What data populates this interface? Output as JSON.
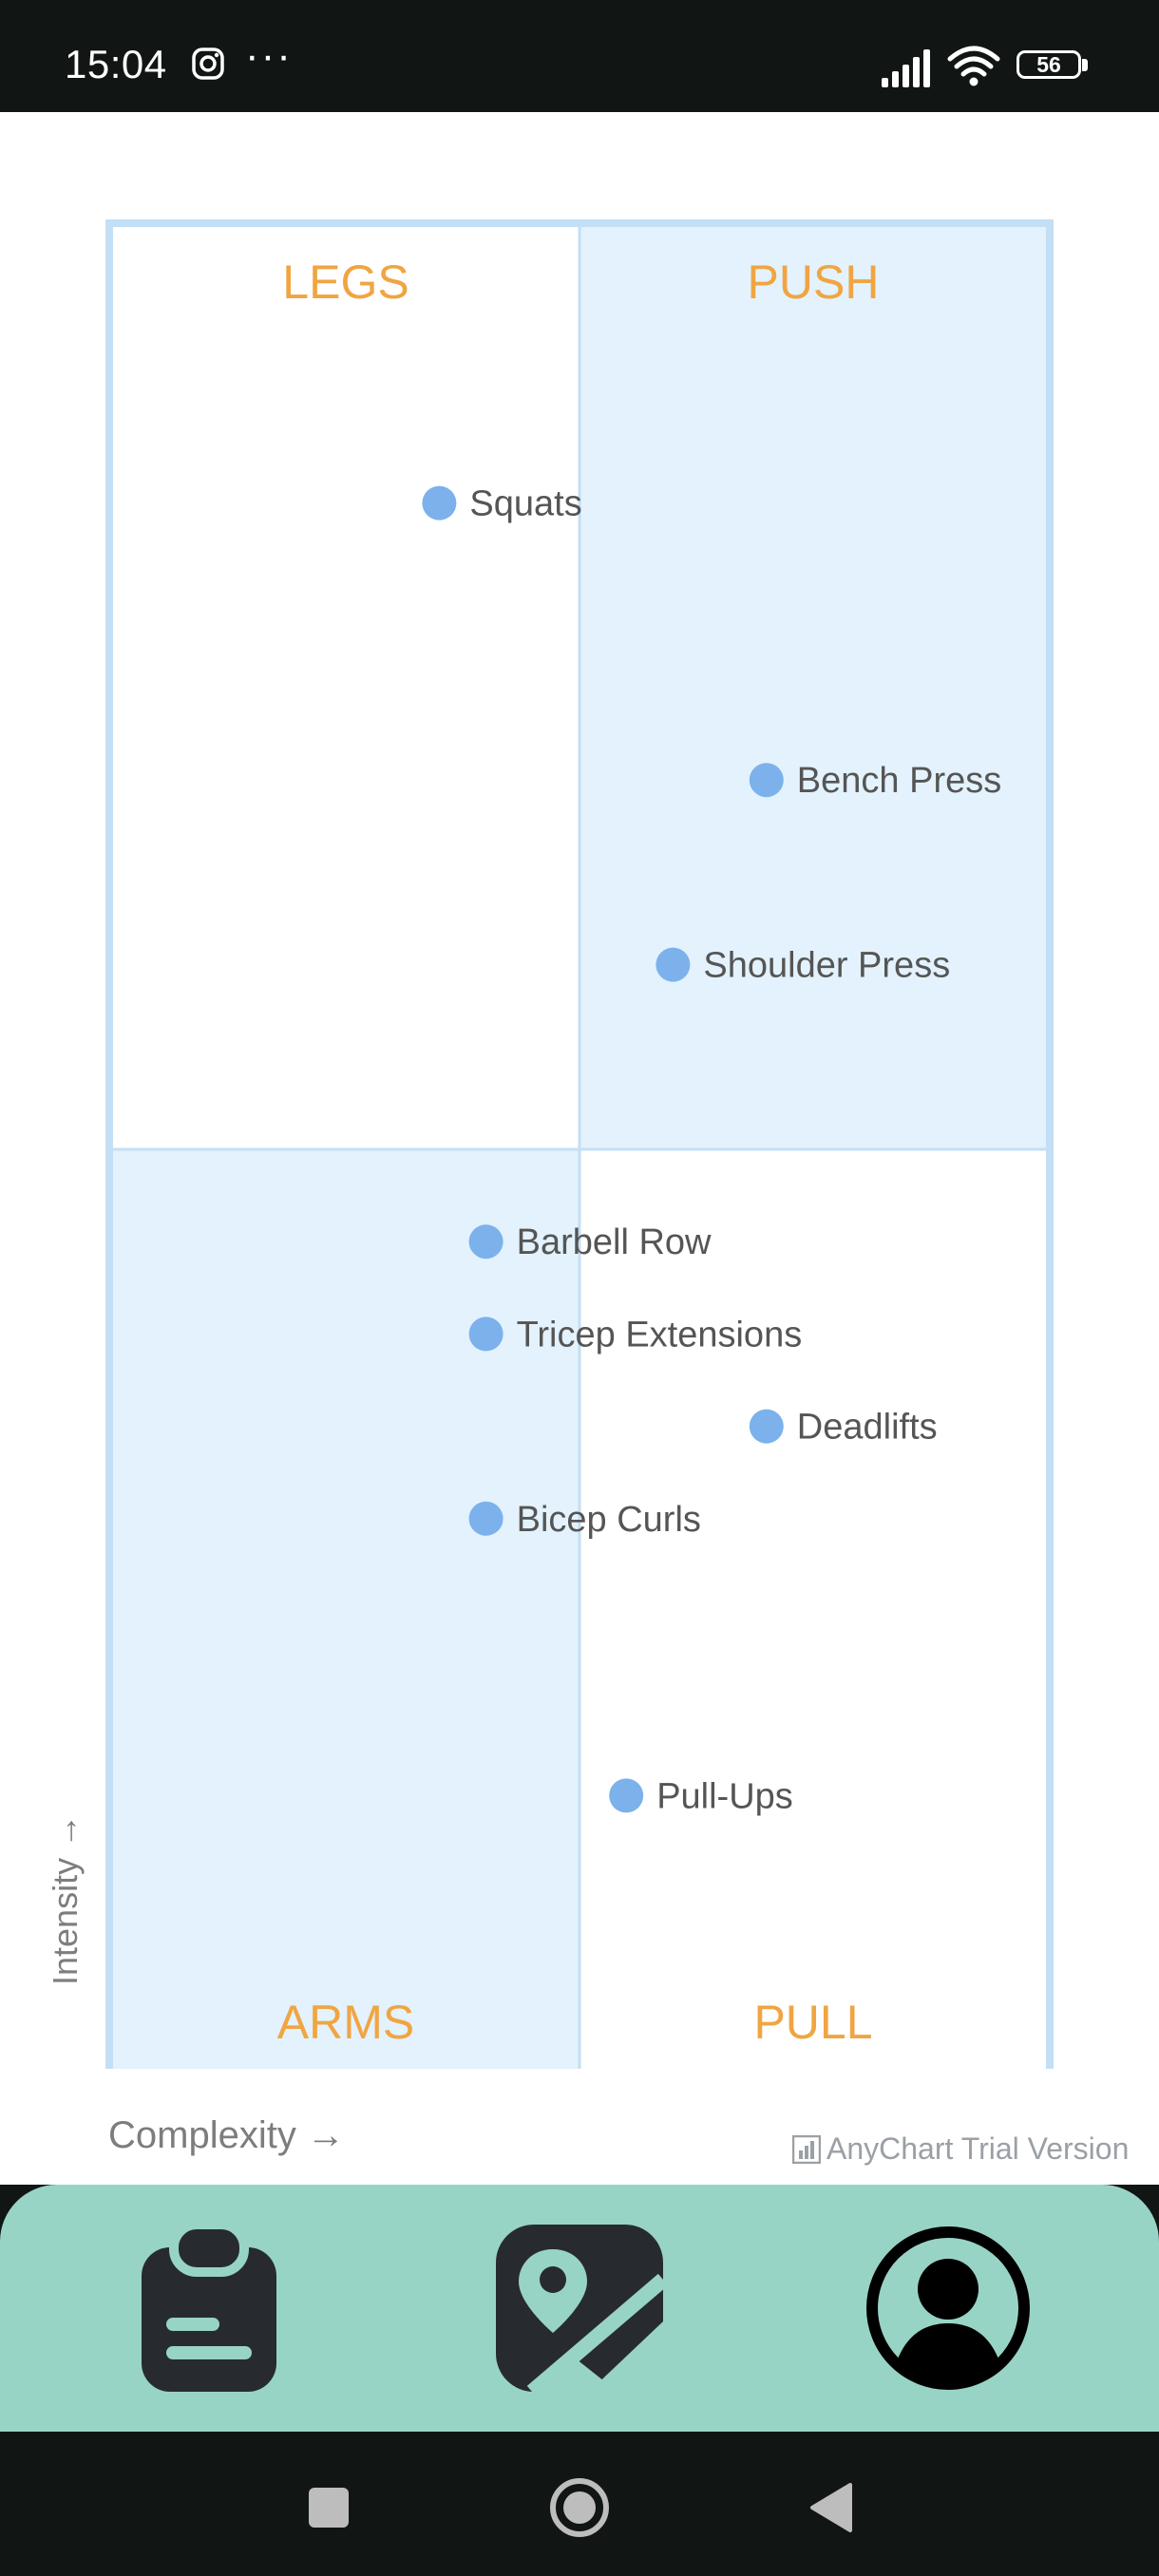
{
  "status_bar": {
    "time": "15:04",
    "more": "···",
    "battery": "56",
    "icons": [
      "instagram-icon",
      "signal-icon",
      "wifi-icon",
      "battery-icon"
    ]
  },
  "chart_data": {
    "type": "scatter",
    "subtype": "quadrant",
    "xlabel": "Complexity →",
    "ylabel": "Intensity →",
    "xlim": [
      0,
      100
    ],
    "ylim": [
      0,
      100
    ],
    "grid": false,
    "legend": "none",
    "quadrants": [
      {
        "label": "LEGS",
        "position": "top-left",
        "fill": "#ffffff"
      },
      {
        "label": "PUSH",
        "position": "top-right",
        "fill": "#e3f2fc"
      },
      {
        "label": "ARMS",
        "position": "bottom-left",
        "fill": "#e3f2fc"
      },
      {
        "label": "PULL",
        "position": "bottom-right",
        "fill": "#ffffff"
      }
    ],
    "points": [
      {
        "name": "Squats",
        "x": 35,
        "y": 85
      },
      {
        "name": "Bench Press",
        "x": 70,
        "y": 70
      },
      {
        "name": "Shoulder Press",
        "x": 60,
        "y": 60
      },
      {
        "name": "Barbell Row",
        "x": 40,
        "y": 45
      },
      {
        "name": "Tricep Extensions",
        "x": 40,
        "y": 40
      },
      {
        "name": "Deadlifts",
        "x": 70,
        "y": 35
      },
      {
        "name": "Bicep Curls",
        "x": 40,
        "y": 30
      },
      {
        "name": "Pull-Ups",
        "x": 55,
        "y": 15
      }
    ],
    "colors": {
      "marker": "#7cb1ec",
      "quadrant_label": "#f0a542",
      "border": "#c3dff5",
      "point_label": "#555555"
    }
  },
  "credits": {
    "text": "AnyChart Trial Version",
    "icon": "anychart-logo-icon"
  },
  "bottom_nav": {
    "items": [
      {
        "icon": "clipboard-icon"
      },
      {
        "icon": "image-edit-icon"
      },
      {
        "icon": "account-circle-icon"
      }
    ],
    "color": "#98d4c5"
  },
  "system_nav": {
    "icons": [
      "recents-icon",
      "home-icon",
      "back-icon"
    ]
  }
}
